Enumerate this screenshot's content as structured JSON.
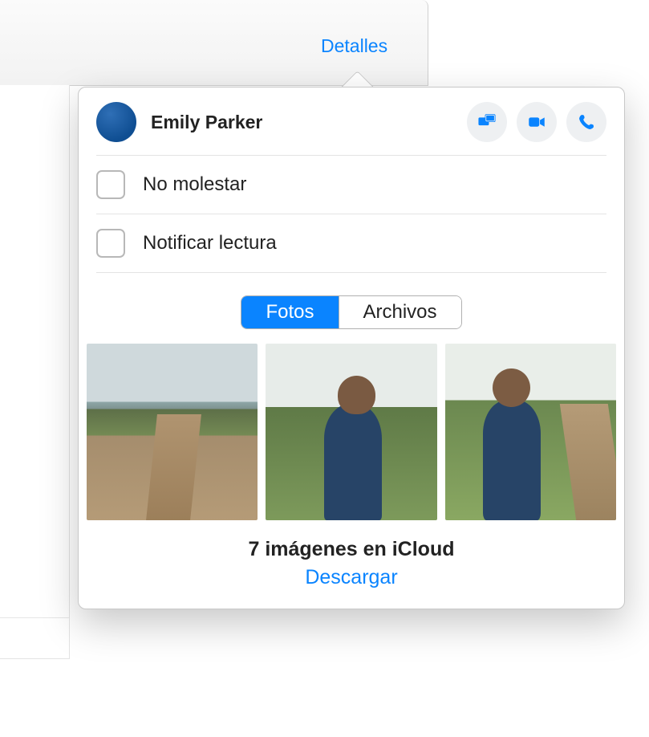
{
  "header": {
    "details_link": "Detalles"
  },
  "contact": {
    "name": "Emily Parker"
  },
  "actions": {
    "screenshare": "screen-share-icon",
    "video": "video-icon",
    "audio": "phone-icon"
  },
  "options": {
    "do_not_disturb": {
      "label": "No molestar",
      "checked": false
    },
    "read_receipts": {
      "label": "Notificar lectura",
      "checked": false
    }
  },
  "tabs": {
    "photos": "Fotos",
    "files": "Archivos",
    "active": "photos"
  },
  "cloud": {
    "summary": "7 imágenes en iCloud",
    "download": "Descargar"
  },
  "colors": {
    "accent": "#0a84ff"
  }
}
